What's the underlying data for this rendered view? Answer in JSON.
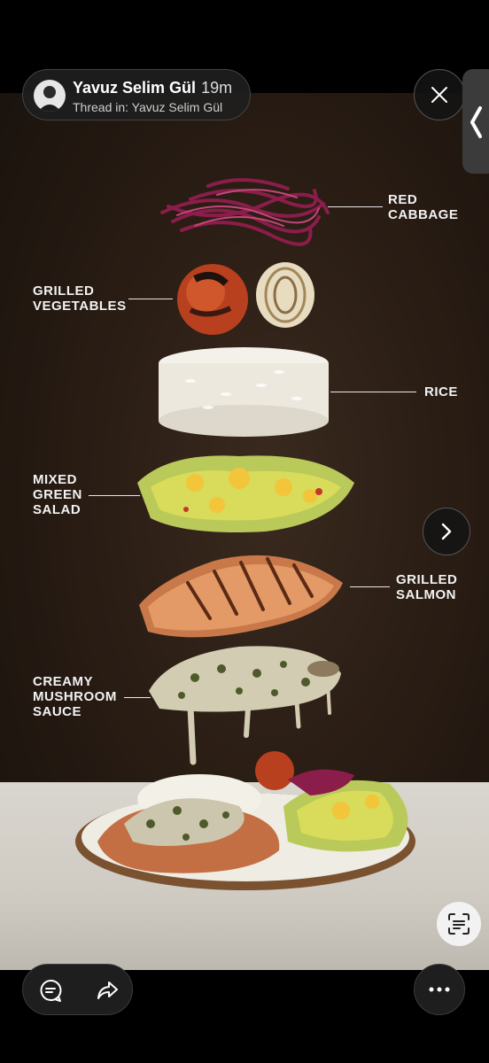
{
  "header": {
    "user_name": "Yavuz Selim Gül",
    "time": "19m",
    "thread": "Thread in: Yavuz Selim Gül"
  },
  "labels": {
    "red_cabbage": "RED\nCABBAGE",
    "grilled_vegetables": "GRILLED\nVEGETABLES",
    "rice": "RICE",
    "mixed_green_salad": "MIXED\nGREEN\nSALAD",
    "grilled_salmon": "GRILLED\nSALMON",
    "creamy_mushroom_sauce": "CREAMY\nMUSHROOM\nSAUCE"
  },
  "icons": {
    "close": "close-icon",
    "next": "chevron-right-icon",
    "side_tab": "chevron-left-icon",
    "comment": "comment-icon",
    "share": "share-icon",
    "more": "more-icon",
    "scan": "scan-text-icon"
  }
}
